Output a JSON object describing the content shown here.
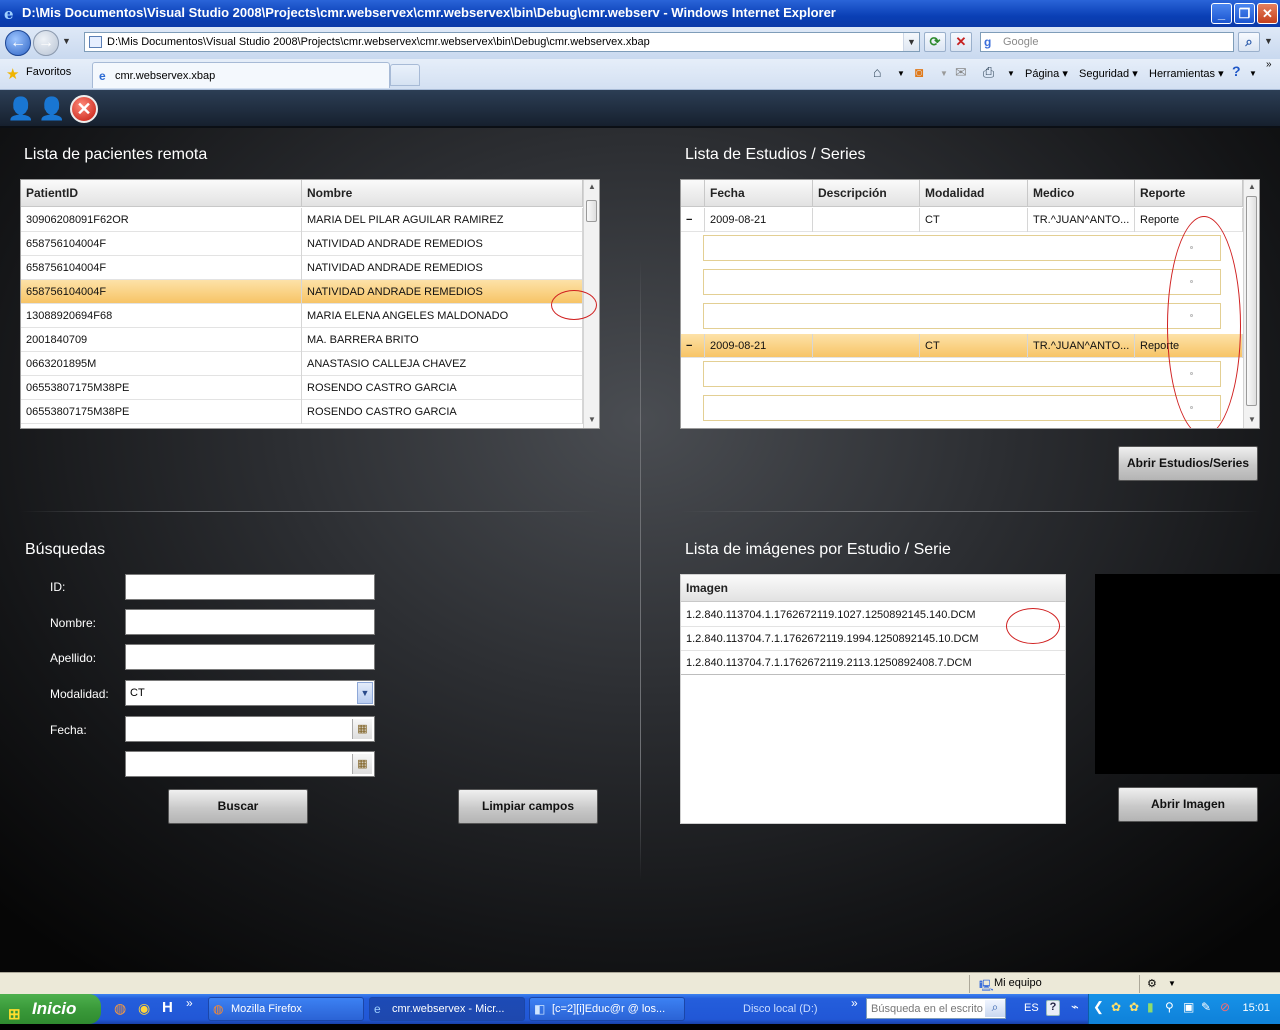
{
  "window": {
    "title": "D:\\Mis Documentos\\Visual Studio 2008\\Projects\\cmr.webservex\\cmr.webservex\\bin\\Debug\\cmr.webserv - Windows Internet Explorer"
  },
  "browser": {
    "address": "D:\\Mis Documentos\\Visual Studio 2008\\Projects\\cmr.webservex\\cmr.webservex\\bin\\Debug\\cmr.webservex.xbap",
    "search_placeholder": "Google",
    "favorites_label": "Favoritos",
    "tab_title": "cmr.webservex.xbap",
    "commands": {
      "page": "Página",
      "security": "Seguridad",
      "tools": "Herramientas"
    }
  },
  "patients": {
    "title": "Lista de pacientes remota",
    "columns": [
      "PatientID",
      "Nombre"
    ],
    "rows": [
      {
        "id": "30906208091F62OR",
        "name": "MARIA  DEL  PILAR AGUILAR  RAMIREZ"
      },
      {
        "id": "658756104004F",
        "name": "NATIVIDAD ANDRADE REMEDIOS"
      },
      {
        "id": "658756104004F",
        "name": "NATIVIDAD ANDRADE REMEDIOS"
      },
      {
        "id": "658756104004F",
        "name": "NATIVIDAD ANDRADE REMEDIOS"
      },
      {
        "id": "13088920694F68",
        "name": "MARIA ELENA ANGELES MALDONADO"
      },
      {
        "id": "2001840709",
        "name": "MA. BARRERA BRITO"
      },
      {
        "id": "0663201895M",
        "name": "ANASTASIO CALLEJA CHAVEZ"
      },
      {
        "id": "06553807175M38PE",
        "name": "ROSENDO CASTRO GARCIA"
      },
      {
        "id": "06553807175M38PE",
        "name": "ROSENDO CASTRO GARCIA"
      }
    ]
  },
  "studies": {
    "title": "Lista de Estudios / Series",
    "columns": [
      "Fecha",
      "Descripción",
      "Modalidad",
      "Medico",
      "Reporte"
    ],
    "rows": [
      {
        "date": "2009-08-21",
        "desc": "",
        "modality": "CT",
        "doctor": "TR.^JUAN^ANTO...",
        "report": "Reporte",
        "expander": "−"
      },
      {
        "date": "2009-08-21",
        "desc": "",
        "modality": "CT",
        "doctor": "TR.^JUAN^ANTO...",
        "report": "Reporte",
        "expander": "−"
      }
    ],
    "open_button": "Abrir Estudios/Series"
  },
  "search": {
    "title": "Búsquedas",
    "id_label": "ID:",
    "name_label": "Nombre:",
    "lastname_label": "Apellido:",
    "modality_label": "Modalidad:",
    "modality_value": "CT",
    "date_label": "Fecha:",
    "search_button": "Buscar",
    "clear_button": "Limpiar campos"
  },
  "images": {
    "title": "Lista de imágenes por Estudio / Serie",
    "column": "Imagen",
    "rows": [
      "1.2.840.113704.1.1762672119.1027.1250892145.140.DCM",
      "1.2.840.113704.7.1.1762672119.1994.1250892145.10.DCM",
      "1.2.840.113704.7.1.1762672119.2113.1250892408.7.DCM"
    ],
    "open_button": "Abrir Imagen"
  },
  "statusbar": {
    "zone": "Mi equipo"
  },
  "taskbar": {
    "start": "Inicio",
    "tasks": [
      "Mozilla Firefox",
      "cmr.webservex - Micr...",
      "[c=2][i]Educ@r @ los..."
    ],
    "drive": "Disco local (D:)",
    "search_placeholder": "Búsqueda en el escrito",
    "lang": "ES",
    "clock": "15:01"
  }
}
